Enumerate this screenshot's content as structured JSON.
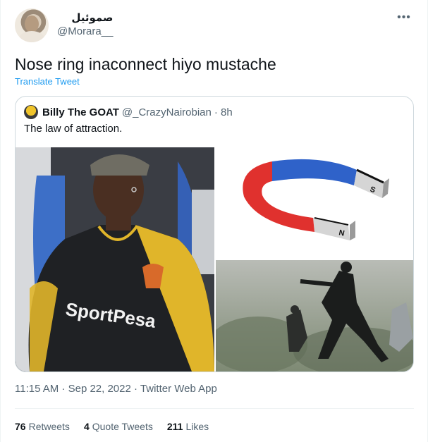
{
  "author": {
    "display_name": "صموئيل",
    "handle": "@Morara__"
  },
  "more_icon": "more-dots-icon",
  "tweet": {
    "text": "Nose ring inaconnect hiyo mustache",
    "translate_label": "Translate Tweet"
  },
  "quote": {
    "name": "Billy The GOAT",
    "handle": "@_CrazyNairobian",
    "time": "· 8h",
    "text": "The law of attraction.",
    "media": {
      "photo_shirt_text": "SportPesa",
      "magnet_pole_s": "S",
      "magnet_pole_n": "N"
    }
  },
  "footer": {
    "timestamp": "11:15 AM · Sep 22, 2022 · Twitter Web App"
  },
  "stats": {
    "retweets_count": "76",
    "retweets_label": "Retweets",
    "quotes_count": "4",
    "quotes_label": "Quote Tweets",
    "likes_count": "211",
    "likes_label": "Likes"
  },
  "colors": {
    "link": "#1d9bf0",
    "secondary_text": "#536471",
    "magnet_red": "#e0312e",
    "magnet_blue": "#2f62c9"
  }
}
